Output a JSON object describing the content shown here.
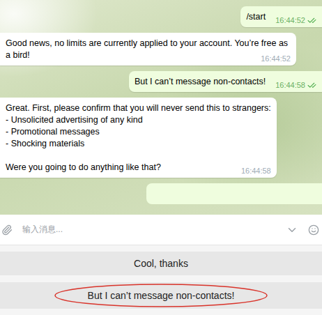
{
  "messages": [
    {
      "kind": "outgoing",
      "text": "/start",
      "time": "16:44:52",
      "read": true
    },
    {
      "kind": "incoming",
      "text": "Good news, no limits are currently applied to your account. You’re free as a bird!",
      "time": "16:44:52",
      "read": false
    },
    {
      "kind": "outgoing",
      "text": "But I can’t message non-contacts!",
      "time": "16:44:58",
      "read": true
    },
    {
      "kind": "incoming",
      "text": "Great. First, please confirm that you will never send this to strangers:\n- Unsolicited advertising of any kind\n- Promotional messages\n- Shocking materials\n\nWere you going to do anything like that?",
      "time": "16:44:58",
      "read": false
    },
    {
      "kind": "clipped",
      "text": "",
      "time": "",
      "read": false
    }
  ],
  "composer": {
    "placeholder": "输入消息..."
  },
  "keyboard": [
    {
      "label": "Cool, thanks",
      "highlighted": false
    },
    {
      "label": "But I can’t message non-contacts!",
      "highlighted": true
    }
  ]
}
